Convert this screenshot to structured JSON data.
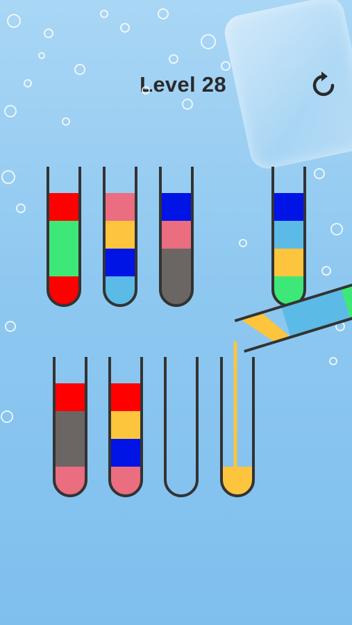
{
  "header": {
    "level_label": "Level 28",
    "restart_icon": "restart-icon"
  },
  "colors": {
    "red": "#ff0000",
    "green": "#3ee878",
    "pink": "#ea6d80",
    "orange": "#fdc43d",
    "blue": "#0014e6",
    "lightblue": "#5bbbe6",
    "gray": "#6b6563"
  },
  "tubes": [
    {
      "id": "tube-1",
      "layers": [
        "red",
        "green",
        "green",
        "red"
      ]
    },
    {
      "id": "tube-2",
      "layers": [
        "pink",
        "orange",
        "blue",
        "lightblue"
      ]
    },
    {
      "id": "tube-3",
      "layers": [
        "blue",
        "pink",
        "gray",
        "gray"
      ]
    },
    {
      "id": "tube-4",
      "layers": [
        "blue",
        "lightblue",
        "orange",
        "green"
      ]
    },
    {
      "id": "tube-5",
      "layers": [
        "red",
        "gray",
        "gray",
        "pink"
      ]
    },
    {
      "id": "tube-6",
      "layers": [
        "red",
        "orange",
        "blue",
        "pink"
      ]
    },
    {
      "id": "tube-7",
      "layers": []
    },
    {
      "id": "tube-8",
      "layers": [
        "orange"
      ],
      "receiving_pour": true
    }
  ],
  "tilted_tube": {
    "id": "tube-9",
    "layers": [
      "green",
      "lightblue",
      "lightblue"
    ],
    "pouring": "orange",
    "pours_into": "tube-8"
  }
}
